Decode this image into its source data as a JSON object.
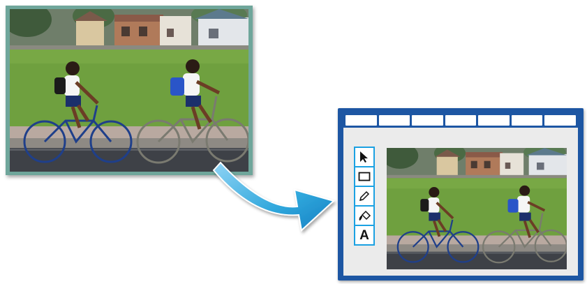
{
  "photo": {
    "subject": "two-boys-riding-bicycles",
    "frame_color": "#6fa69b"
  },
  "arrow": {
    "icon": "curved-arrow-icon",
    "color": "#2fa7dc"
  },
  "app_window": {
    "border_color": "#1d56a3",
    "menu_count": 7,
    "tools": [
      {
        "name": "select-arrow-icon"
      },
      {
        "name": "rectangle-icon"
      },
      {
        "name": "pencil-icon"
      },
      {
        "name": "fill-icon"
      },
      {
        "name": "text-icon",
        "label": "A"
      }
    ]
  }
}
